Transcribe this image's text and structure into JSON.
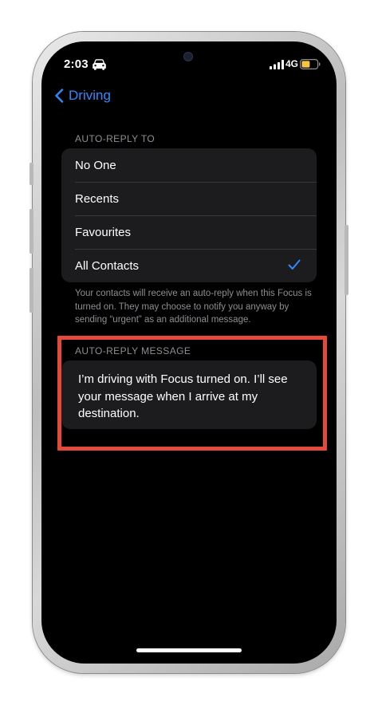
{
  "status_bar": {
    "time": "2:03",
    "network": "4G",
    "icons": {
      "driving": "car-icon",
      "signal": "cellular-signal-icon",
      "battery": "battery-icon"
    },
    "battery_color": "#f5c542"
  },
  "nav": {
    "back_label": "Driving",
    "back_icon": "chevron-left-icon"
  },
  "auto_reply_to": {
    "header": "AUTO-REPLY TO",
    "options": [
      {
        "label": "No One",
        "selected": false
      },
      {
        "label": "Recents",
        "selected": false
      },
      {
        "label": "Favourites",
        "selected": false
      },
      {
        "label": "All Contacts",
        "selected": true
      }
    ],
    "check_icon": "checkmark-icon",
    "footer": "Your contacts will receive an auto-reply when this Focus is turned on. They may choose to notify you anyway by sending “urgent” as an additional message."
  },
  "auto_reply_message": {
    "header": "AUTO-REPLY MESSAGE",
    "text": "I’m driving with Focus turned on. I’ll see your message when I arrive at my destination."
  },
  "colors": {
    "accent": "#2e8bff",
    "highlight": "#e5493a",
    "cell_background": "#1c1c1e",
    "secondary_text": "#8e8e93"
  }
}
